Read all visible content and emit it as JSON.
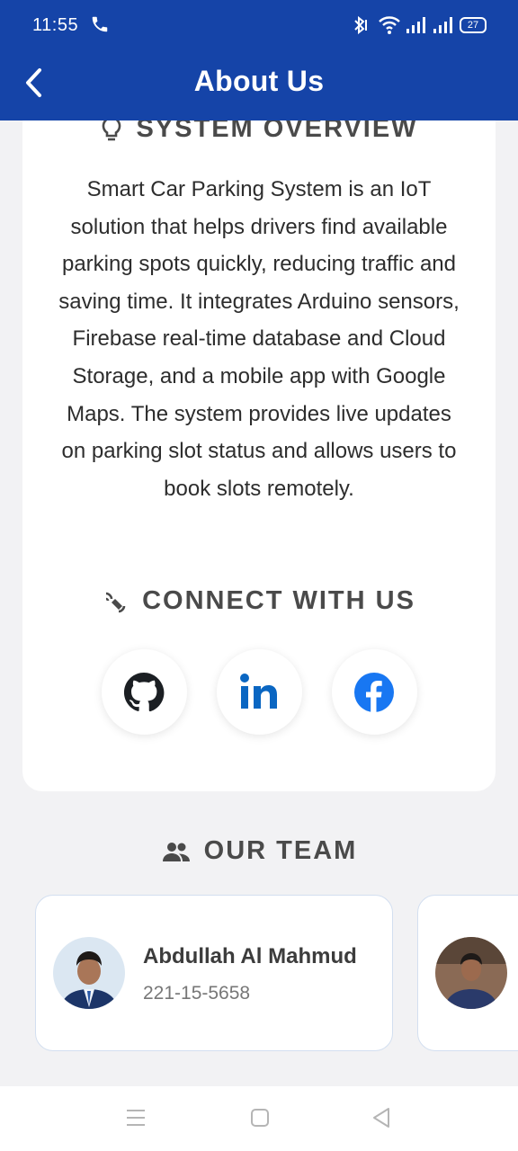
{
  "status_bar": {
    "time": "11:55",
    "battery": "27",
    "icons": [
      "phone-call-icon",
      "bluetooth-icon",
      "wifi-icon",
      "signal-icon",
      "signal-icon",
      "battery-icon"
    ]
  },
  "app_bar": {
    "title": "About Us",
    "back_icon": "chevron-left-icon"
  },
  "overview": {
    "icon": "lightbulb-icon",
    "heading": "SYSTEM OVERVIEW",
    "body": "Smart Car Parking System is an IoT solution that helps drivers find available parking spots quickly, reducing traffic and saving time. It integrates Arduino sensors, Firebase real-time database and Cloud Storage, and a mobile app with Google Maps. The system provides live updates on parking slot status and allows users to book slots remotely."
  },
  "connect": {
    "icon": "connect-signal-icon",
    "heading": "CONNECT WITH US",
    "links": [
      {
        "name": "github-icon",
        "color": "#1b1f23"
      },
      {
        "name": "linkedin-icon",
        "color": "#0a66c2"
      },
      {
        "name": "facebook-icon",
        "color": "#1877f2"
      }
    ]
  },
  "team": {
    "icon": "group-icon",
    "heading": "OUR TEAM",
    "members": [
      {
        "name": "Abdullah Al Mahmud",
        "id": "221-15-5658"
      },
      {
        "name": "",
        "id": ""
      }
    ]
  },
  "colors": {
    "primary": "#1544a8",
    "background": "#f2f2f4",
    "card": "#ffffff",
    "heading_text": "#4a4a4a"
  },
  "nav_bar": {
    "icons": [
      "menu-icon",
      "home-square-icon",
      "back-triangle-icon"
    ]
  }
}
